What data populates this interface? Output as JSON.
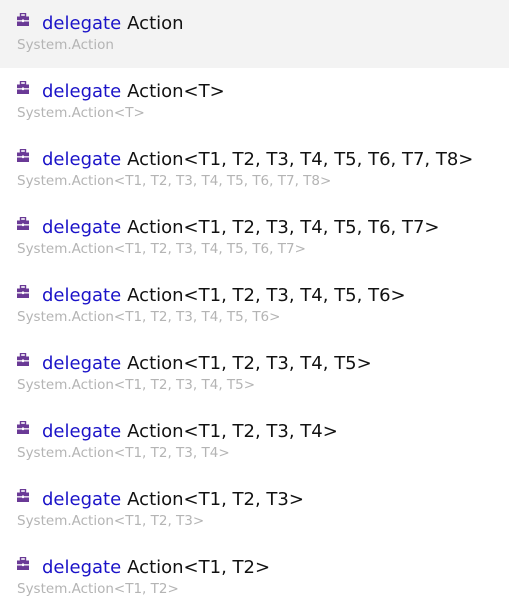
{
  "accent_keyword_color": "#1a12c8",
  "icon_color": "#6a3a96",
  "items": [
    {
      "icon": "delegate-icon",
      "keyword": "delegate",
      "signature": "Action",
      "qualified": "System.Action",
      "selected": true
    },
    {
      "icon": "delegate-icon",
      "keyword": "delegate",
      "signature": "Action<T>",
      "qualified": "System.Action<T>",
      "selected": false
    },
    {
      "icon": "delegate-icon",
      "keyword": "delegate",
      "signature": "Action<T1, T2, T3, T4, T5, T6, T7, T8>",
      "qualified": "System.Action<T1, T2, T3, T4, T5, T6, T7, T8>",
      "selected": false
    },
    {
      "icon": "delegate-icon",
      "keyword": "delegate",
      "signature": "Action<T1, T2, T3, T4, T5, T6, T7>",
      "qualified": "System.Action<T1, T2, T3, T4, T5, T6, T7>",
      "selected": false
    },
    {
      "icon": "delegate-icon",
      "keyword": "delegate",
      "signature": "Action<T1, T2, T3, T4, T5, T6>",
      "qualified": "System.Action<T1, T2, T3, T4, T5, T6>",
      "selected": false
    },
    {
      "icon": "delegate-icon",
      "keyword": "delegate",
      "signature": "Action<T1, T2, T3, T4, T5>",
      "qualified": "System.Action<T1, T2, T3, T4, T5>",
      "selected": false
    },
    {
      "icon": "delegate-icon",
      "keyword": "delegate",
      "signature": "Action<T1, T2, T3, T4>",
      "qualified": "System.Action<T1, T2, T3, T4>",
      "selected": false
    },
    {
      "icon": "delegate-icon",
      "keyword": "delegate",
      "signature": "Action<T1, T2, T3>",
      "qualified": "System.Action<T1, T2, T3>",
      "selected": false
    },
    {
      "icon": "delegate-icon",
      "keyword": "delegate",
      "signature": "Action<T1, T2>",
      "qualified": "System.Action<T1, T2>",
      "selected": false
    }
  ]
}
